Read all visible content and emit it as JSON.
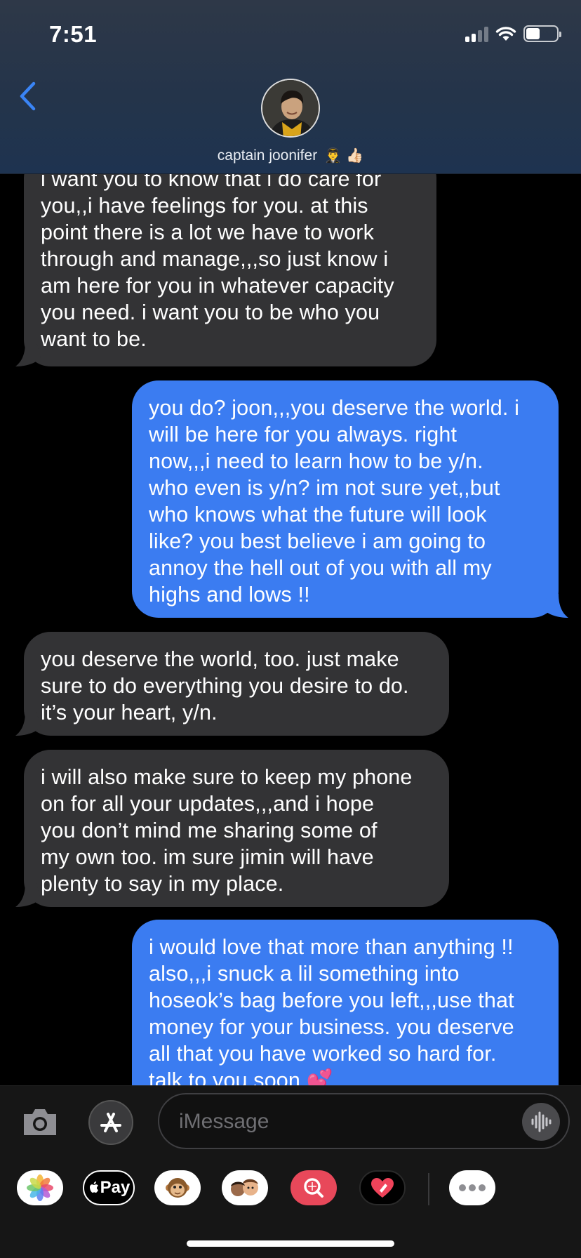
{
  "status_bar": {
    "time": "7:51"
  },
  "contact": {
    "name": "captain joonifer",
    "name_emoji": "👨‍✈️ 👍🏻"
  },
  "messages": [
    {
      "direction": "incoming",
      "lines": [
        "i want you to know that i do care for",
        "you,,i have feelings for you. at this",
        "point there is a lot we have to work",
        "through and manage,,,so just know i",
        "am here for you in whatever capacity",
        "you need. i want you to be who you",
        "want to be."
      ]
    },
    {
      "direction": "outgoing",
      "lines": [
        "you do? joon,,,you deserve the world. i",
        "will be here for you always. right",
        "now,,,i need to learn how to be y/n.",
        "who even is y/n? im not sure yet,,but",
        "who knows what the future will look",
        "like? you best believe i am going to",
        "annoy the hell out of you with all my",
        "highs and lows !!"
      ]
    },
    {
      "direction": "incoming",
      "lines": [
        "you deserve the world, too. just make",
        "sure to do everything you desire to do.",
        "it’s your heart, y/n."
      ]
    },
    {
      "direction": "incoming",
      "lines": [
        "i will also make sure to keep my phone",
        "on for all your updates,,,and i hope",
        "you don’t mind me sharing some of",
        "my own too. im sure jimin will have",
        "plenty to say in my place."
      ]
    },
    {
      "direction": "outgoing",
      "lines": [
        "i would love that more than anything !!",
        "also,,,i snuck a lil something into",
        "hoseok’s bag before you left,,,use that",
        "money for your business. you deserve",
        "all that you have worked so hard for.",
        "talk to you soon 💕"
      ]
    }
  ],
  "input": {
    "placeholder": "iMessage"
  },
  "app_strip": {
    "apple_pay_label": "Pay"
  }
}
